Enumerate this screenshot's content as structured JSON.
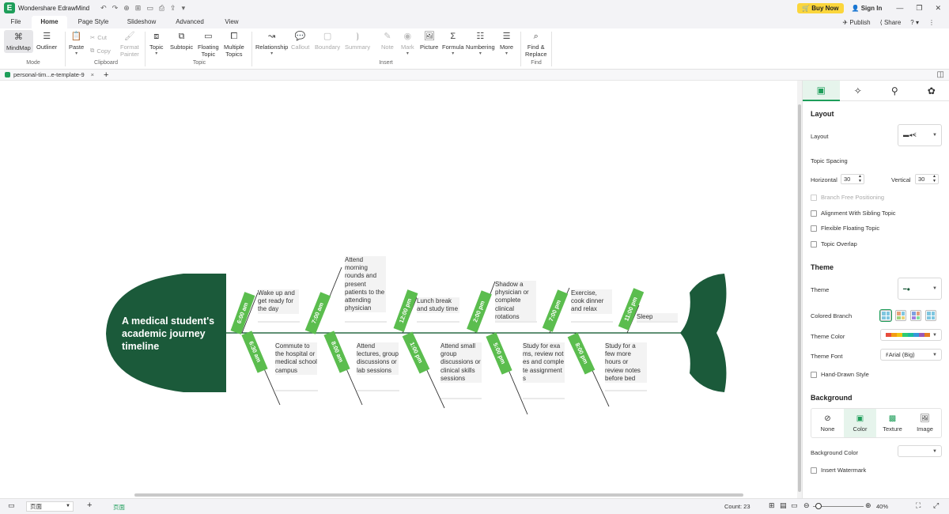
{
  "titlebar": {
    "logo": "E",
    "app_name": "Wondershare EdrawMind",
    "buy_now": "Buy Now",
    "sign_in": "Sign In",
    "quick_access": [
      "↶",
      "↷",
      "⊕",
      "⊞",
      "▭",
      "⎙",
      "⇪",
      "▾"
    ],
    "window": [
      "—",
      "❐",
      "✕"
    ]
  },
  "menu": {
    "items": [
      "File",
      "Home",
      "Page Style",
      "Slideshow",
      "Advanced",
      "View"
    ],
    "active": "Home",
    "publish": "Publish",
    "share": "Share",
    "help": "?"
  },
  "ribbon": {
    "mindmap": "MindMap",
    "outliner": "Outliner",
    "mode": "Mode",
    "paste": "Paste",
    "cut": "Cut",
    "copy": "Copy",
    "format": "Format",
    "painter": "Painter",
    "clipboard": "Clipboard",
    "topic": "Topic",
    "subtopic": "Subtopic",
    "floating": "Floating",
    "topic2": "Topic",
    "multiple": "Multiple",
    "topics": "Topics",
    "topic_group": "Topic",
    "relationship": "Relationship",
    "callout": "Callout",
    "boundary": "Boundary",
    "summary": "Summary",
    "note": "Note",
    "mark": "Mark",
    "picture": "Picture",
    "formula": "Formula",
    "numbering": "Numbering",
    "more": "More",
    "insert": "Insert",
    "find": "Find &",
    "replace": "Replace",
    "find_group": "Find"
  },
  "tab": {
    "name": "personal-tim...e-template-9",
    "close": "×",
    "add": "+"
  },
  "diagram": {
    "title": "A medical student's academic journey timeline",
    "colors": {
      "main": "#1b5a3a",
      "label": "#5bbd4e",
      "spine": "#2b6b47"
    },
    "upper": [
      {
        "time": "6:00 am",
        "text": "Wake up and get ready for the day"
      },
      {
        "time": "7:00 am",
        "text": "Attend morning rounds and present patients to the attending physician"
      },
      {
        "time": "12:00 pm",
        "text": "Lunch break and study time"
      },
      {
        "time": "2:00 pm",
        "text": "Shadow a physician or complete clinical rotations"
      },
      {
        "time": "7:00 pm",
        "text": "Exercise, cook dinner and relax"
      },
      {
        "time": "11:00 pm",
        "text": "Sleep"
      }
    ],
    "lower": [
      {
        "time": "6:30 am",
        "text": "Commute to the hospital or medical school campus"
      },
      {
        "time": "8:00 am",
        "text": "Attend lectures, group discussions or lab sessions"
      },
      {
        "time": "1:00 pm",
        "text": "Attend small group discussions or clinical skills sessions"
      },
      {
        "time": "5:00 pm",
        "text": "Study for exams, review notes and complete assignments"
      },
      {
        "time": "8:00 pm",
        "text": "Study for a few more hours or review notes before bed"
      }
    ]
  },
  "panel": {
    "tabs": [
      "▣",
      "✧",
      "⚲",
      "✿"
    ],
    "layout_header": "Layout",
    "layout_label": "Layout",
    "layout_value": "▬◂ᗕ",
    "topic_spacing": "Topic Spacing",
    "horizontal": "Horizontal",
    "horizontal_value": "30",
    "vertical": "Vertical",
    "vertical_value": "30",
    "branch_free": "Branch Free Positioning",
    "alignment": "Alignment With Sibling Topic",
    "flexible": "Flexible Floating Topic",
    "overlap": "Topic Overlap",
    "theme_header": "Theme",
    "theme_label": "Theme",
    "theme_value": "━●",
    "colored_branch": "Colored Branch",
    "theme_color": "Theme Color",
    "theme_font": "Theme Font",
    "theme_font_value": "Arial (Big)",
    "hand_drawn": "Hand-Drawn Style",
    "background_header": "Background",
    "bg_options": [
      "None",
      "Color",
      "Texture",
      "Image"
    ],
    "bg_selected": "Color",
    "bg_color": "Background Color",
    "watermark": "Insert Watermark",
    "palette": [
      "#e74c3c",
      "#f39c12",
      "#f1c40f",
      "#2ecc71",
      "#1abc9c",
      "#3498db",
      "#9b59b6",
      "#e67e22"
    ]
  },
  "status": {
    "page_icon": "▭",
    "page_name": "页面",
    "add": "+",
    "page_tab": "页面",
    "count": "Count: 23",
    "zoom": "40%",
    "minus": "⊖",
    "plus": "⊕"
  }
}
